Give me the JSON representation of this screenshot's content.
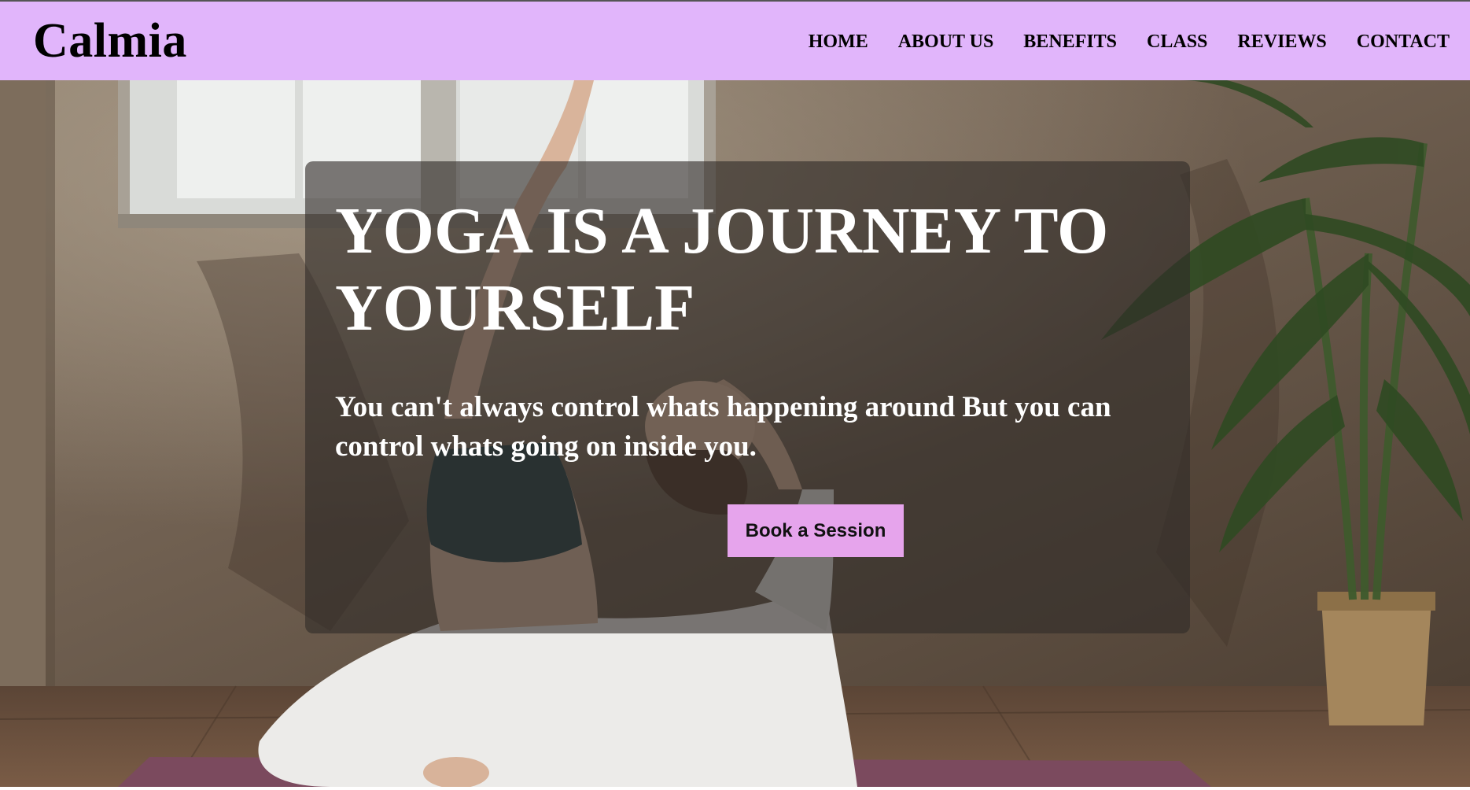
{
  "brand": {
    "logo_text": "Calmia"
  },
  "nav": {
    "items": [
      {
        "label": "HOME"
      },
      {
        "label": "ABOUT US"
      },
      {
        "label": "BENEFITS"
      },
      {
        "label": "CLASS"
      },
      {
        "label": "REVIEWS"
      },
      {
        "label": "CONTACT"
      }
    ]
  },
  "hero": {
    "title": "YOGA IS A JOURNEY TO YOURSELF",
    "subtitle": "You can't always control whats happening around But you can control whats going on inside you.",
    "cta_label": "Book a Session"
  },
  "colors": {
    "navbar_bg": "#e1b5fb",
    "cta_bg": "#e6a4ec",
    "overlay": "rgba(48,44,40,0.62)"
  }
}
